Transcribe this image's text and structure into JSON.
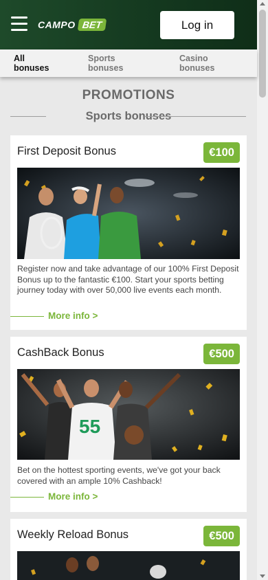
{
  "header": {
    "logo_part1": "CAMPO",
    "logo_part2": "BET",
    "login_label": "Log in"
  },
  "tabs": [
    {
      "line1": "All",
      "line2": "bonuses",
      "active": true
    },
    {
      "line1": "Sports",
      "line2": "bonuses",
      "active": false
    },
    {
      "line1": "Casino",
      "line2": "bonuses",
      "active": false
    }
  ],
  "page": {
    "title": "PROMOTIONS",
    "section": "Sports bonuses"
  },
  "cards": [
    {
      "title": "First Deposit Bonus",
      "badge": "€100",
      "image": "tennis-players-celebrating-image",
      "description": "Register now and take advantage of our 100% First Deposit Bonus up to the fantastic €100. Start your sports betting journey today with over 50,000 live events each month.",
      "more": "More info >"
    },
    {
      "title": "CashBack Bonus",
      "badge": "€500",
      "image": "football-players-celebrating-image",
      "jersey_number": "55",
      "description": "Bet on the hottest sporting events, we've got your back covered with an ample 10% Cashback!",
      "more": "More info >"
    },
    {
      "title": "Weekly Reload Bonus",
      "badge": "€500",
      "image": "athletes-in-stadium-image"
    }
  ],
  "colors": {
    "brand_green": "#7bb63a",
    "header_dark_green": "#153a20"
  }
}
